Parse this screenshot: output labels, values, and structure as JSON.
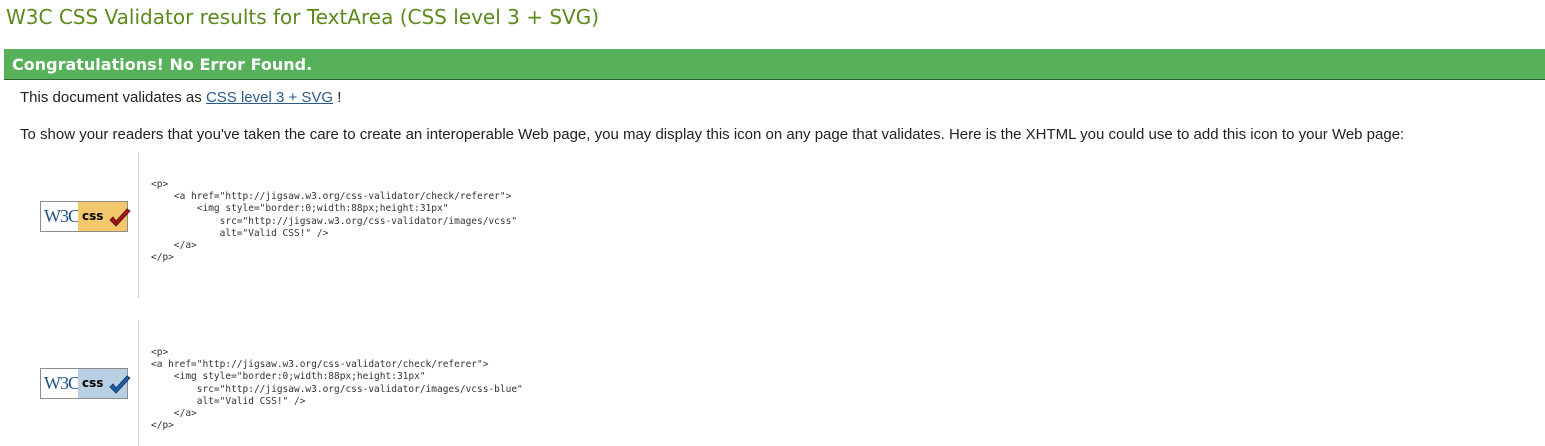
{
  "page": {
    "title": "W3C CSS Validator results for TextArea (CSS level 3 + SVG)"
  },
  "banner": {
    "text": "Congratulations! No Error Found."
  },
  "validates": {
    "prefix": "This document validates as ",
    "link_label": "CSS level 3 + SVG",
    "suffix": " !"
  },
  "info": {
    "text": "To show your readers that you've taken the care to create an interoperable Web page, you may display this icon on any page that validates. Here is the XHTML you could use to add this icon to your Web page:"
  },
  "badges": [
    {
      "logo_text": "W3C",
      "css_text": "css",
      "check_color": "#a31515",
      "snippet": "<p>\n    <a href=\"http://jigsaw.w3.org/css-validator/check/referer\">\n        <img style=\"border:0;width:88px;height:31px\"\n            src=\"http://jigsaw.w3.org/css-validator/images/vcss\"\n            alt=\"Valid CSS!\" />\n    </a>\n</p>"
    },
    {
      "logo_text": "W3C",
      "css_text": "css",
      "check_color": "#1f5fa8",
      "snippet": "<p>\n<a href=\"http://jigsaw.w3.org/css-validator/check/referer\">\n    <img style=\"border:0;width:88px;height:31px\"\n        src=\"http://jigsaw.w3.org/css-validator/images/vcss-blue\"\n        alt=\"Valid CSS!\" />\n    </a>\n</p>"
    }
  ],
  "colors": {
    "title": "#5c8a1a",
    "banner": "#57b05a",
    "link": "#2b5a8f",
    "badge_gold": "#f3c76c",
    "badge_blue": "#b9cfe4"
  }
}
